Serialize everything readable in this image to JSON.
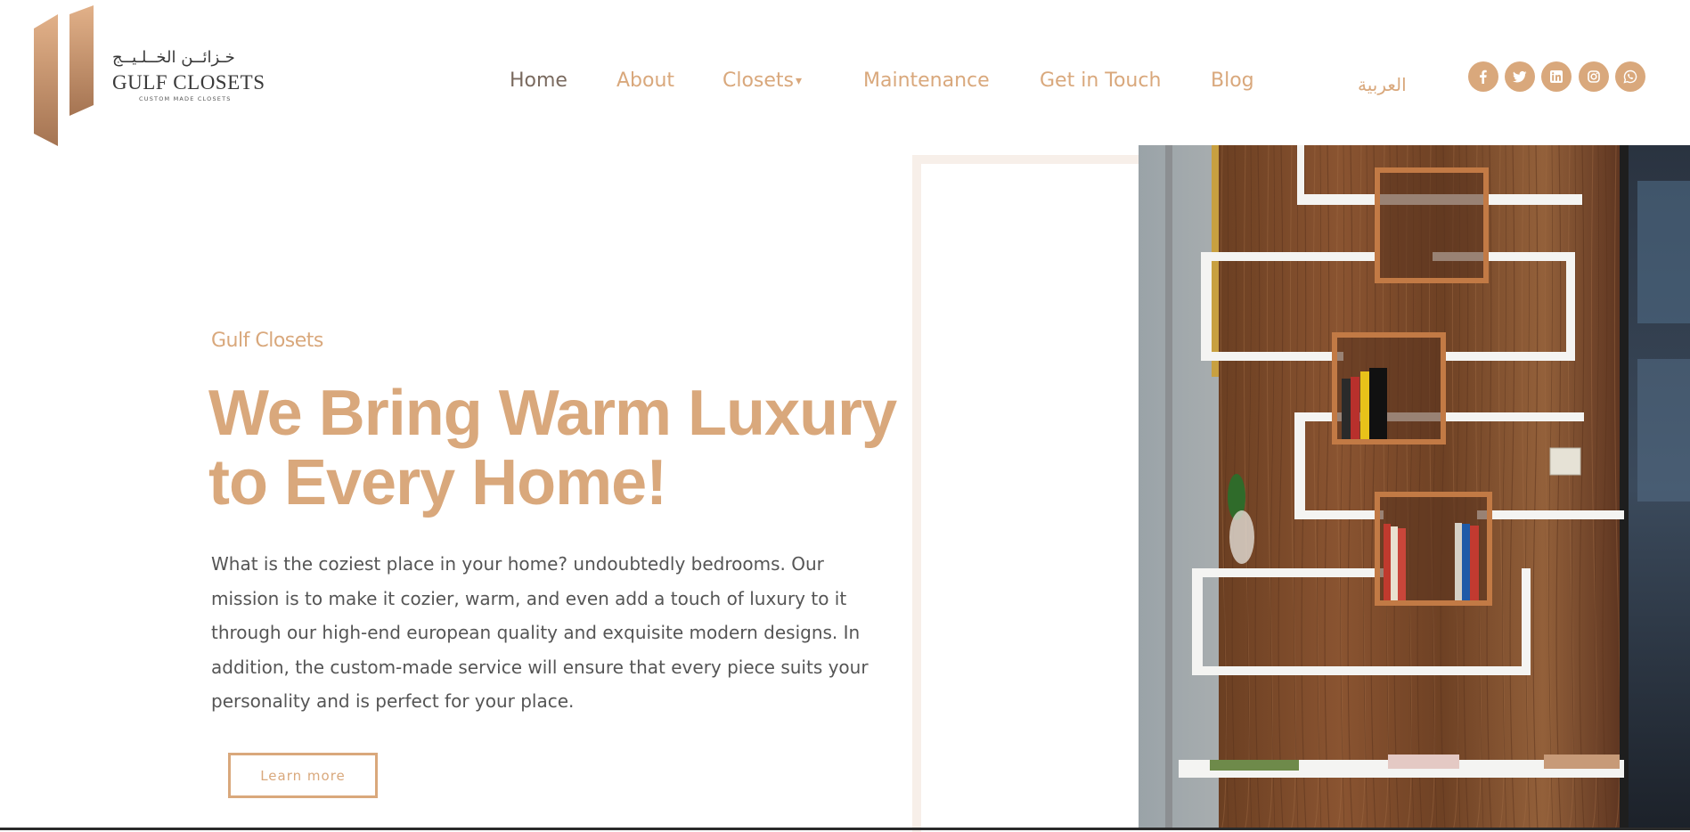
{
  "brand": {
    "arabic_name": "خـزائــن الخــلـيــج",
    "name": "GULF CLOSETS",
    "tagline": "CUSTOM MADE CLOSETS"
  },
  "nav": {
    "items": [
      {
        "label": "Home"
      },
      {
        "label": "About"
      },
      {
        "label": "Closets"
      },
      {
        "label": "Maintenance"
      },
      {
        "label": "Get in Touch"
      },
      {
        "label": "Blog"
      }
    ],
    "active": "Home",
    "language_toggle": "العربية"
  },
  "social": [
    "facebook-icon",
    "twitter-icon",
    "linkedin-icon",
    "instagram-icon",
    "whatsapp-icon"
  ],
  "hero": {
    "eyebrow": "Gulf  Closets",
    "headline_line1": "We Bring Warm Luxury",
    "headline_line2": "to Every Home!",
    "body": "What is the coziest place in your home? undoubtedly bedrooms. Our mission is to make it cozier, warm, and even add a touch of luxury to it through our high-end european quality and exquisite modern designs. In addition, the custom-made service will ensure that every piece suits your personality and is perfect for your place.",
    "cta": "Learn more"
  },
  "colors": {
    "accent": "#d9a87c",
    "nav_active": "#7a6a5f",
    "body_text": "#555555",
    "frame": "#f7efe9",
    "wood": "#7a4a2b"
  }
}
